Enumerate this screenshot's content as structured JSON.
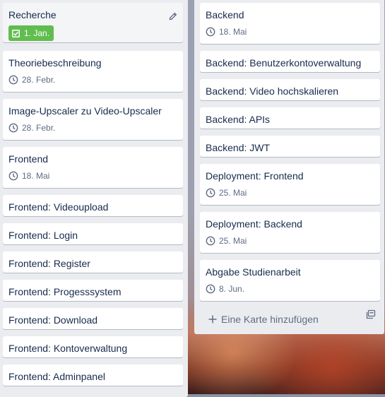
{
  "left_list": {
    "cards": [
      {
        "title": "Recherche",
        "badge": "1. Jan.",
        "badge_type": "done",
        "editing": true
      },
      {
        "title": "Theoriebeschreibung",
        "date": "28. Febr."
      },
      {
        "title": "Image-Upscaler zu Video-Upscaler",
        "date": "28. Febr."
      },
      {
        "title": "Frontend",
        "date": "18. Mai"
      },
      {
        "title": "Frontend: Videoupload"
      },
      {
        "title": "Frontend: Login"
      },
      {
        "title": "Frontend: Register"
      },
      {
        "title": "Frontend: Progesssystem"
      },
      {
        "title": "Frontend: Download"
      },
      {
        "title": "Frontend: Kontoverwaltung"
      },
      {
        "title": "Frontend: Adminpanel"
      }
    ]
  },
  "right_list": {
    "cards": [
      {
        "title": "Backend",
        "date": "18. Mai"
      },
      {
        "title": "Backend: Benutzerkontoverwaltung"
      },
      {
        "title": "Backend: Video hochskalieren"
      },
      {
        "title": "Backend: APIs"
      },
      {
        "title": "Backend: JWT"
      },
      {
        "title": "Deployment: Frontend",
        "date": "25. Mai"
      },
      {
        "title": "Deployment: Backend",
        "date": "25. Mai"
      },
      {
        "title": "Abgabe Studienarbeit",
        "date": "8. Jun."
      }
    ],
    "add_card_label": "Eine Karte hinzufügen"
  },
  "colors": {
    "done_badge": "#61bd4f",
    "list_bg": "#ebecf0",
    "card_text": "#172b4d",
    "meta_text": "#5e6c84"
  },
  "icons": [
    "clock-icon",
    "checkbox-icon",
    "pencil-icon",
    "plus-icon",
    "template-icon"
  ]
}
